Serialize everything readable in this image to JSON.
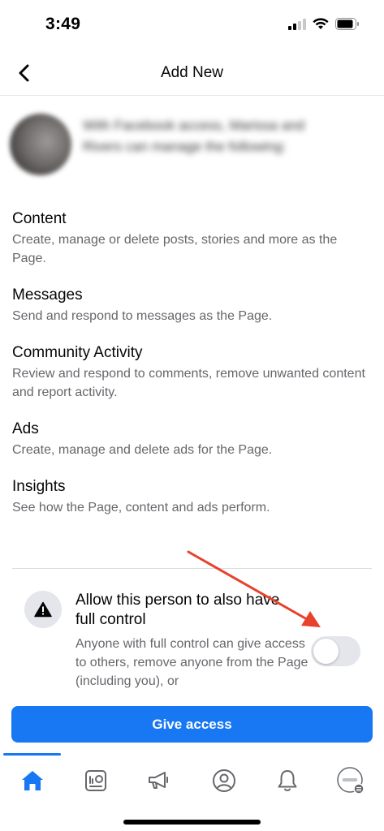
{
  "status_bar": {
    "time": "3:49"
  },
  "header": {
    "title": "Add New"
  },
  "profile": {
    "text": "With Facebook access, Marissa and Rivers can manage the following:"
  },
  "permissions": [
    {
      "title": "Content",
      "description": "Create, manage or delete posts, stories and more as the Page."
    },
    {
      "title": "Messages",
      "description": "Send and respond to messages as the Page."
    },
    {
      "title": "Community Activity",
      "description": "Review and respond to comments, remove unwanted content and report activity."
    },
    {
      "title": "Ads",
      "description": "Create, manage and delete ads for the Page."
    },
    {
      "title": "Insights",
      "description": "See how the Page, content and ads perform."
    }
  ],
  "full_control": {
    "title": "Allow this person to also have full control",
    "description": "Anyone with full control can give access to others, remove anyone from the Page (including you), or",
    "toggle_on": false
  },
  "primary_button": {
    "label": "Give access"
  },
  "tab_bar": {
    "active_tab": "home",
    "tabs": [
      "home-icon",
      "dashboard-icon",
      "megaphone-icon",
      "profile-icon",
      "bell-icon",
      "page-avatar-icon"
    ]
  },
  "colors": {
    "accent": "#1877f2",
    "annotation_arrow": "#e8412c"
  }
}
